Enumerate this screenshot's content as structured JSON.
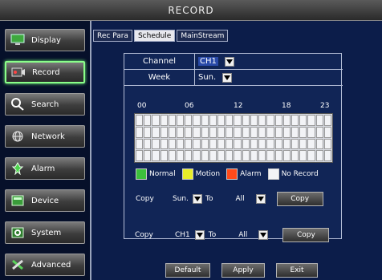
{
  "window": {
    "title": "RECORD"
  },
  "sidebar": {
    "items": [
      {
        "label": "Display",
        "icon": "monitor-icon",
        "active": false
      },
      {
        "label": "Record",
        "icon": "record-icon",
        "active": true
      },
      {
        "label": "Search",
        "icon": "search-icon",
        "active": false
      },
      {
        "label": "Network",
        "icon": "globe-icon",
        "active": false
      },
      {
        "label": "Alarm",
        "icon": "alarm-icon",
        "active": false
      },
      {
        "label": "Device",
        "icon": "device-icon",
        "active": false
      },
      {
        "label": "System",
        "icon": "gear-icon",
        "active": false
      },
      {
        "label": "Advanced",
        "icon": "tools-icon",
        "active": false
      }
    ]
  },
  "tabs": [
    {
      "label": "Rec Para",
      "active": false
    },
    {
      "label": "Schedule",
      "active": true
    },
    {
      "label": "MainStream",
      "active": false
    }
  ],
  "schedule": {
    "channel_label": "Channel",
    "channel_value": "CH1",
    "week_label": "Week",
    "week_value": "Sun.",
    "hour_labels": [
      "00",
      "06",
      "12",
      "18",
      "23"
    ],
    "legend": [
      {
        "label": "Normal",
        "color": "#3cc03c"
      },
      {
        "label": "Motion",
        "color": "#e8ee2a"
      },
      {
        "label": "Alarm",
        "color": "#ff4a1a"
      },
      {
        "label": "No Record",
        "color": "#f2f3f6"
      }
    ],
    "copy_week": {
      "copy_label": "Copy",
      "from": "Sun.",
      "to_label": "To",
      "to": "All",
      "button": "Copy"
    },
    "copy_channel": {
      "copy_label": "Copy",
      "from": "CH1",
      "to_label": "To",
      "to": "All",
      "button": "Copy"
    }
  },
  "footer": {
    "default_label": "Default",
    "apply_label": "Apply",
    "exit_label": "Exit"
  },
  "colors": {
    "accent_active": "#8aff8a",
    "background": "#0c1d4a"
  }
}
